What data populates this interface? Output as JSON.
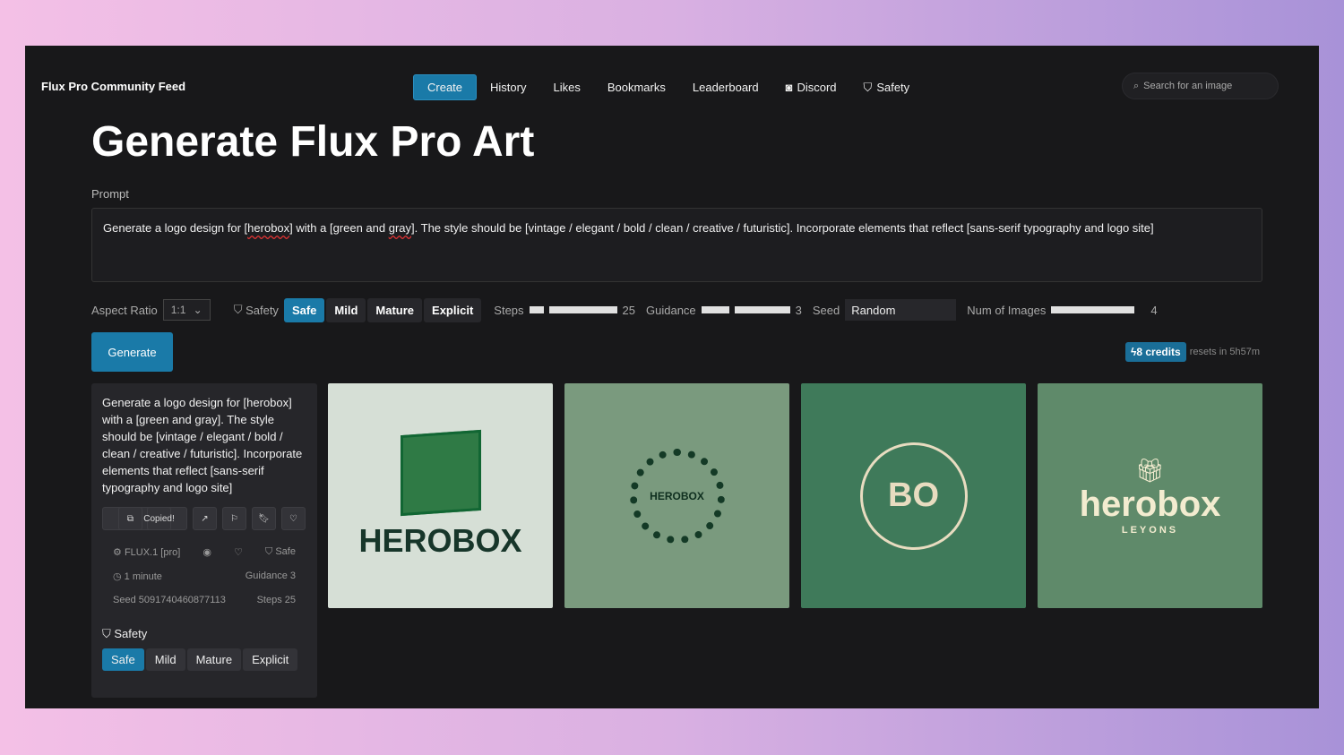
{
  "header": {
    "brand": "Flux Pro Community Feed",
    "nav": [
      "Create",
      "History",
      "Likes",
      "Bookmarks",
      "Leaderboard",
      "Discord",
      "Safety"
    ],
    "search_placeholder": "Search for an image"
  },
  "page_title": "Generate Flux Pro Art",
  "prompt": {
    "label": "Prompt",
    "value_parts": [
      "Generate a logo design for [",
      "herobox",
      "] with a [green and ",
      "gray",
      "]. The style should be [vintage / elegant / bold / clean / creative / futuristic]. Incorporate elements that reflect [sans-serif typography and logo site]"
    ]
  },
  "controls": {
    "aspect_label": "Aspect Ratio",
    "aspect_value": "1:1",
    "safety_label": "Safety",
    "safety_options": [
      "Safe",
      "Mild",
      "Mature",
      "Explicit"
    ],
    "safety_selected": "Safe",
    "steps_label": "Steps",
    "steps_value": "25",
    "guidance_label": "Guidance",
    "guidance_value": "3",
    "seed_label": "Seed",
    "seed_value": "Random",
    "num_label": "Num of Images",
    "num_value": "4"
  },
  "generate_label": "Generate",
  "credits": {
    "value": "8 credits",
    "resets": "resets in 5h57m"
  },
  "card": {
    "prompt": "Generate a logo design for [herobox] with a [green and gray]. The style should be [vintage / elegant / bold / clean / creative / futuristic]. Incorporate elements that reflect [sans-serif typography and logo site]",
    "copied": "Copied!",
    "model": "FLUX.1 [pro]",
    "safety": "Safe",
    "time": "1 minute",
    "guidance": "Guidance 3",
    "seed": "Seed 5091740460877113",
    "steps": "Steps 25",
    "safety_title": "Safety",
    "safety_options": [
      "Safe",
      "Mild",
      "Mature",
      "Explicit"
    ]
  },
  "images": [
    {
      "logo_text": "HEROBOX",
      "bg": "#d6dfd6"
    },
    {
      "logo_text": "HEROBOX",
      "bg": "#7a9a7e"
    },
    {
      "logo_text": "BO",
      "bg": "#3f7a5a"
    },
    {
      "logo_text": "herobox",
      "sub": "LEYONS",
      "bg": "#5f8a6a"
    }
  ],
  "colors": {
    "accent": "#1a7aa8",
    "background": "#18181a"
  }
}
